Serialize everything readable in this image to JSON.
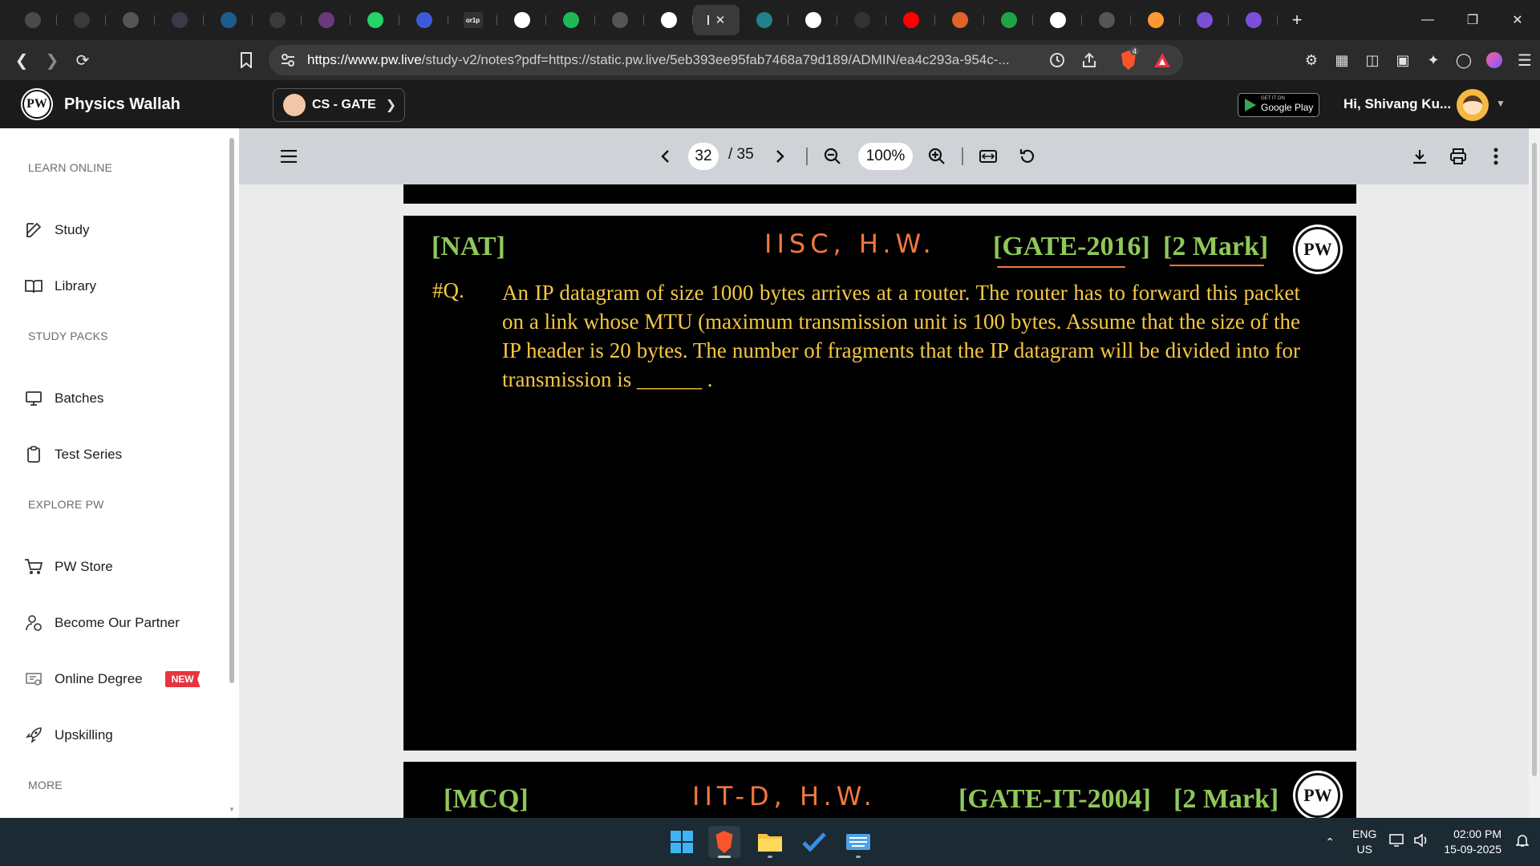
{
  "browser": {
    "tabs": [
      {
        "icon": "app-icon",
        "color": "#4a4a4a"
      },
      {
        "icon": "bitcoin-icon",
        "color": "#3a3a3a"
      },
      {
        "icon": "globe-icon",
        "color": "#555"
      },
      {
        "icon": "mh-icon",
        "color": "#3a3a4a"
      },
      {
        "icon": "wordpress-icon",
        "color": "#1e5c8c"
      },
      {
        "icon": "mh-icon",
        "color": "#3a3a3a"
      },
      {
        "icon": "rocket-icon",
        "color": "#6a3a7a"
      },
      {
        "icon": "whatsapp-icon",
        "color": "#25d366"
      },
      {
        "icon": "feather-icon",
        "color": "#3b5bdb"
      },
      {
        "icon": "orlp-icon",
        "color": "#333"
      },
      {
        "icon": "google-icon",
        "color": "#fff"
      },
      {
        "icon": "spotify-icon",
        "color": "#1db954"
      },
      {
        "icon": "globe-icon",
        "color": "#555"
      },
      {
        "icon": "notion-icon",
        "color": "#fff"
      },
      {
        "icon": "gemini-icon",
        "color": "#4f7be8"
      },
      {
        "icon": "perplexity-icon",
        "color": "#20808d"
      },
      {
        "icon": "google-icon",
        "color": "#fff"
      },
      {
        "icon": "screen-icon",
        "color": "#333"
      },
      {
        "icon": "youtube-icon",
        "color": "#ff0000"
      },
      {
        "icon": "orange-icon",
        "color": "#e2622a"
      },
      {
        "icon": "chart-icon",
        "color": "#1fa344"
      },
      {
        "icon": "wikipedia-icon",
        "color": "#fff"
      },
      {
        "icon": "globe-icon",
        "color": "#555"
      },
      {
        "icon": "india-flag-icon",
        "color": "#ff9933"
      },
      {
        "icon": "target-icon",
        "color": "#7b4fd8"
      },
      {
        "icon": "target-icon",
        "color": "#7b4fd8"
      }
    ],
    "active_tab_index": 14,
    "orlp_label": "or1p",
    "url_host": "https://www.pw.live",
    "url_rest": "/study-v2/notes?pdf=https://static.pw.live/5eb393ee95fab7468a79d189/ADMIN/ea4c293a-954c-...",
    "brave_badge": "4"
  },
  "site": {
    "brand": "Physics Wallah",
    "logo_text": "PW",
    "batch": "CS - GATE",
    "google_play_small": "GET IT ON",
    "google_play_big": "Google Play",
    "greeting": "Hi, Shivang Ku..."
  },
  "sidebar": {
    "sections": [
      "LEARN ONLINE",
      "STUDY PACKS",
      "EXPLORE PW",
      "MORE"
    ],
    "items": [
      {
        "label": "Study",
        "icon": "edit-icon"
      },
      {
        "label": "Library",
        "icon": "book-icon"
      },
      {
        "label": "Batches",
        "icon": "monitor-icon"
      },
      {
        "label": "Test Series",
        "icon": "clipboard-icon"
      },
      {
        "label": "PW Store",
        "icon": "cart-icon"
      },
      {
        "label": "Become Our Partner",
        "icon": "partner-icon"
      },
      {
        "label": "Online Degree",
        "icon": "degree-icon",
        "badge": "NEW"
      },
      {
        "label": "Upskilling",
        "icon": "rocket-icon"
      }
    ]
  },
  "pdf": {
    "current_page": "32",
    "total_pages": "/ 35",
    "zoom": "100%"
  },
  "slides": [
    {
      "tag": "[NAT]",
      "handwritten": "IISC, H.W.",
      "gate": "[GATE-2016]",
      "marks": "[2 Mark]",
      "qnum": "#Q.",
      "question": "An IP datagram of size 1000 bytes arrives at a router. The router has to forward this packet on a link whose MTU (maximum transmission unit is 100 bytes. Assume that the size of the IP header is 20 bytes. The number of fragments that the IP datagram will be divided into for transmission is ______ ."
    },
    {
      "tag": "[MCQ]",
      "handwritten": "IIT-D, H.W.",
      "gate": "[GATE-IT-2004]",
      "marks": "[2 Mark]"
    }
  ],
  "taskbar": {
    "lang_top": "ENG",
    "lang_bottom": "US",
    "time": "02:00 PM",
    "date": "15-09-2025"
  },
  "colors": {
    "slide_green": "#8fc85a",
    "slide_yellow": "#f5c842",
    "annotation_orange": "#f2783c",
    "new_badge": "#e8343f"
  }
}
